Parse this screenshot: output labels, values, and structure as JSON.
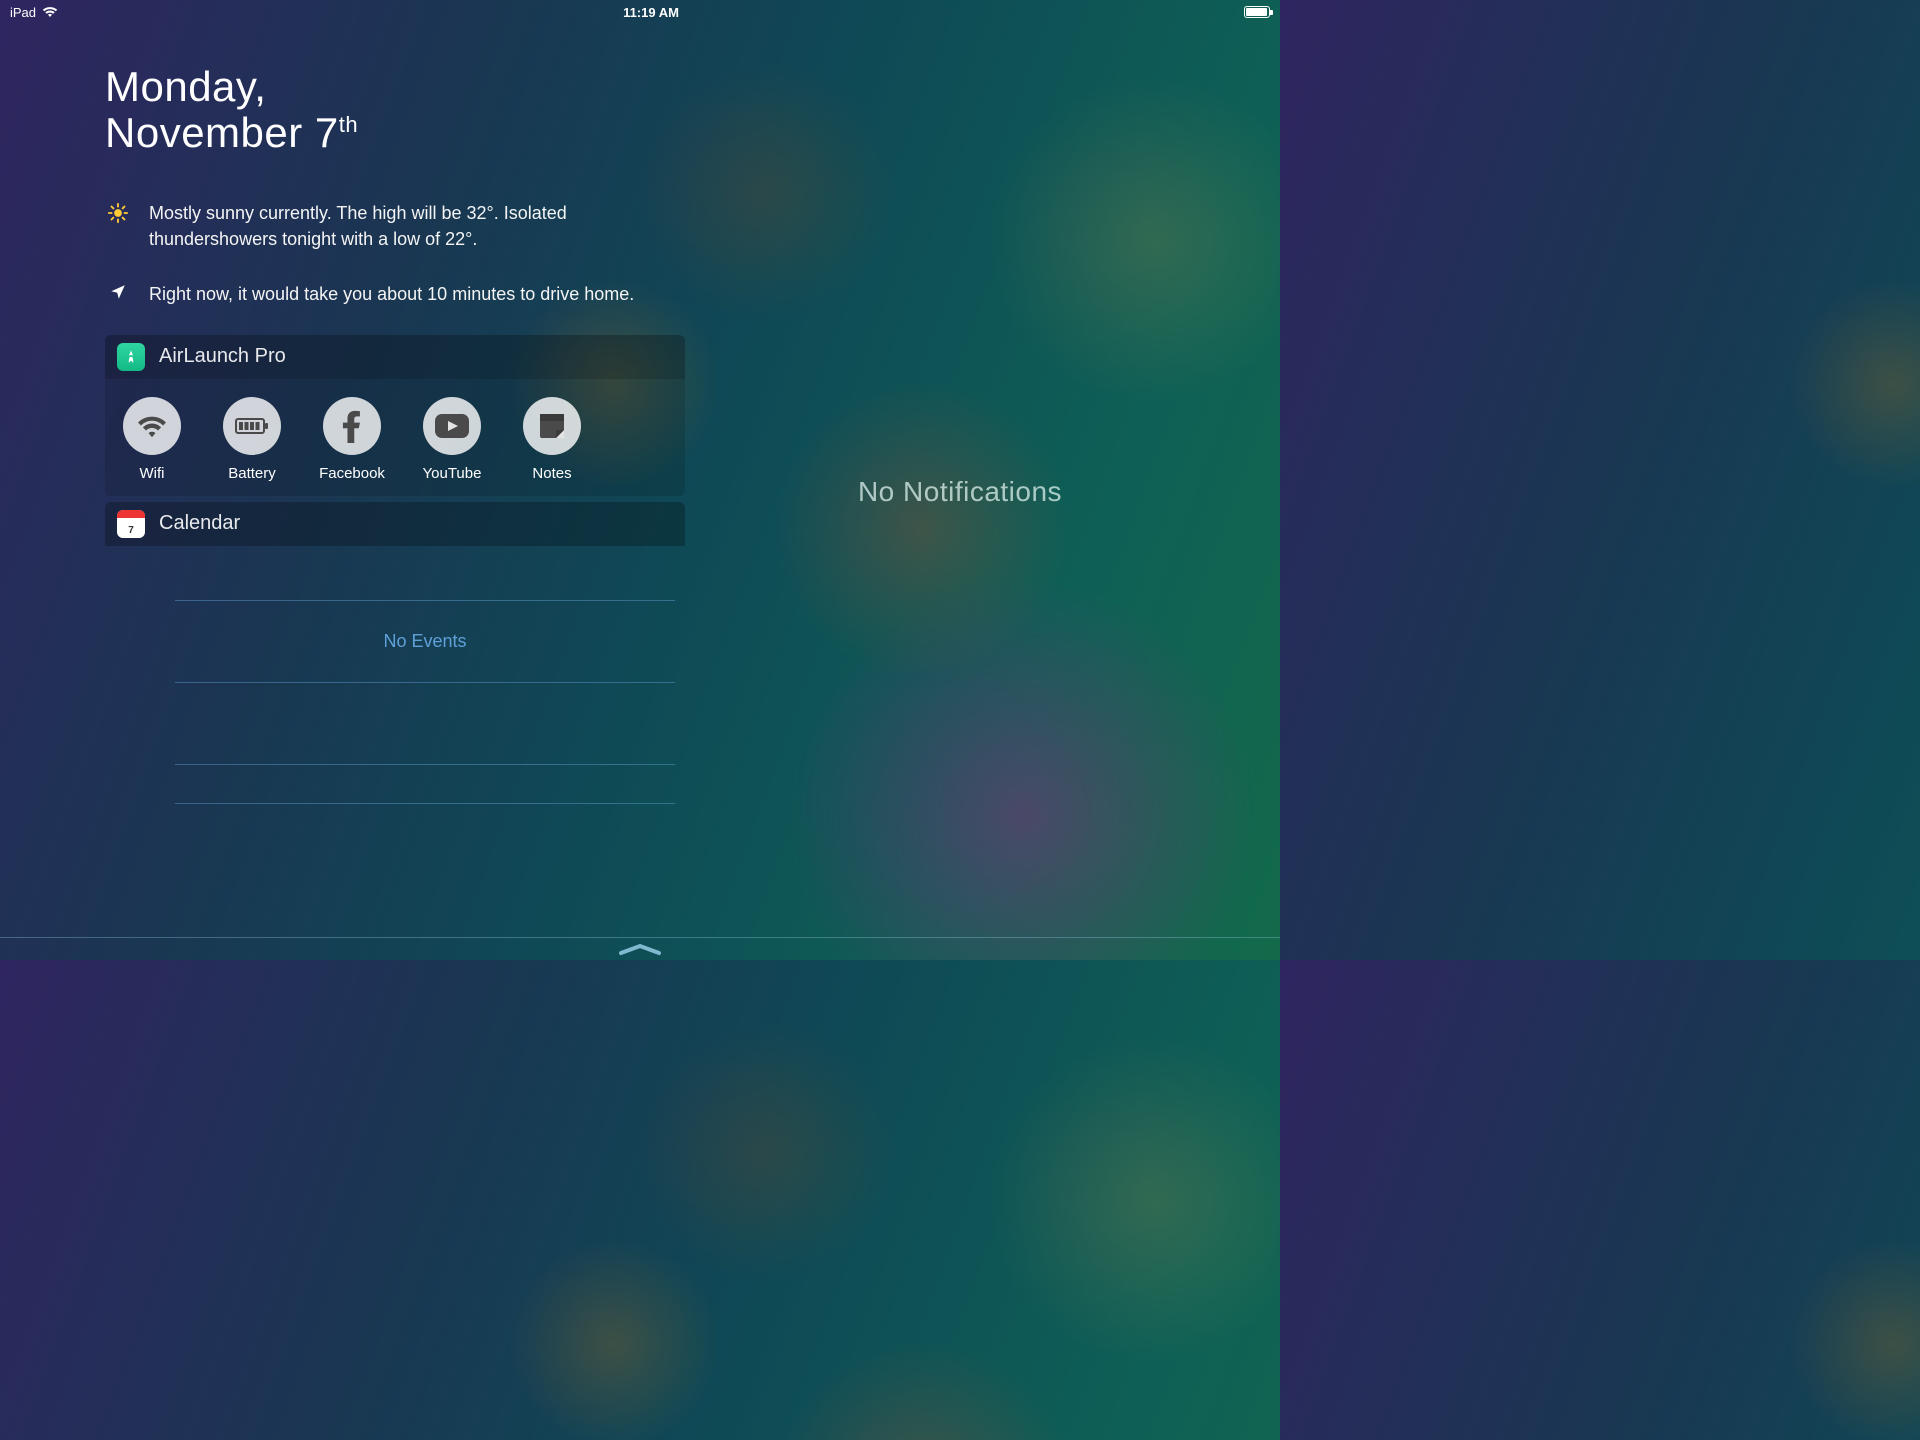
{
  "status": {
    "device_label": "iPad",
    "time": "11:19 AM"
  },
  "date": {
    "day_name": "Monday,",
    "month_day": "November 7",
    "ordinal": "th"
  },
  "summary": {
    "weather": "Mostly sunny currently. The high will be 32°. Isolated thundershowers tonight with a low of 22°.",
    "traffic": "Right now, it would take you about 10 minutes to drive home."
  },
  "widgets": {
    "airlaunch": {
      "title": "AirLaunch Pro",
      "shortcuts": [
        {
          "label": "Wifi",
          "icon": "wifi"
        },
        {
          "label": "Battery",
          "icon": "battery"
        },
        {
          "label": "Facebook",
          "icon": "facebook"
        },
        {
          "label": "YouTube",
          "icon": "youtube"
        },
        {
          "label": "Notes",
          "icon": "notes"
        }
      ]
    },
    "calendar": {
      "title": "Calendar",
      "no_events_label": "No Events"
    }
  },
  "notifications": {
    "empty_label": "No Notifications"
  }
}
